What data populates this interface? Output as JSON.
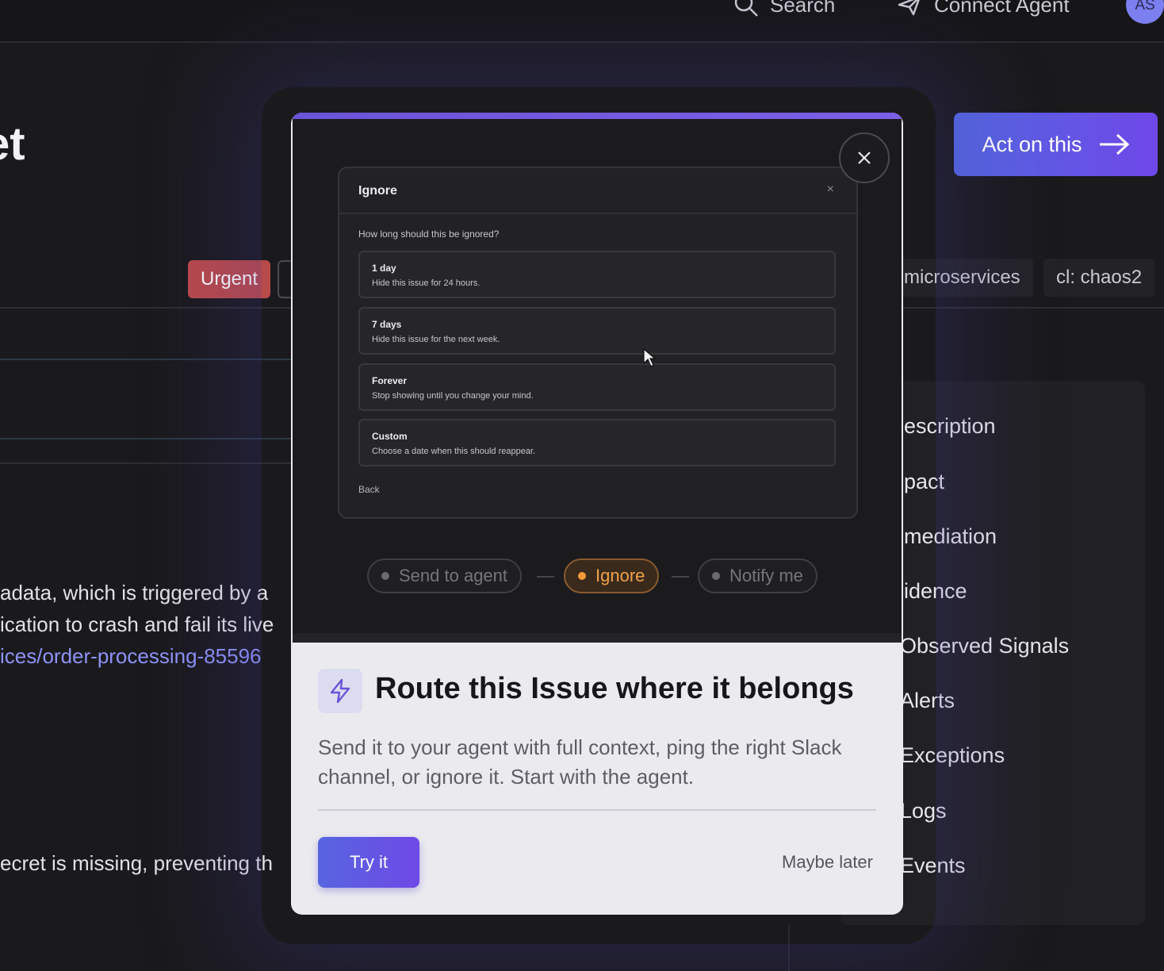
{
  "topbar": {
    "search_label": "Search",
    "connect_label": "Connect Agent",
    "avatar_initials": "AS"
  },
  "page": {
    "title_fragment": "et",
    "act_button_label": "Act on this",
    "tags": [
      "Urgent",
      "microservices",
      "cl: chaos2"
    ],
    "body_lines": [
      "adata, which is triggered by a",
      "ication to crash and fail its live",
      "ices/order-processing-85596",
      "ecret is missing, preventing th"
    ],
    "sidebar_items": [
      "escription",
      "pact",
      "mediation",
      "idence",
      "Observed Signals",
      "Alerts",
      "Exceptions",
      "Logs",
      "Events"
    ]
  },
  "modal": {
    "preview": {
      "dialog_title": "Ignore",
      "dialog_close": "×",
      "question": "How long should this be ignored?",
      "options": [
        {
          "title": "1 day",
          "desc": "Hide this issue for 24 hours."
        },
        {
          "title": "7 days",
          "desc": "Hide this issue for the next week."
        },
        {
          "title": "Forever",
          "desc": "Stop showing until you change your mind."
        },
        {
          "title": "Custom",
          "desc": "Choose a date when this should reappear."
        }
      ],
      "back_label": "Back",
      "steps": [
        "Send to agent",
        "Ignore",
        "Notify me"
      ],
      "active_step": "Ignore"
    },
    "title": "Route this Issue where it belongs",
    "description": "Send it to your agent with full context, ping the right Slack channel, or ignore it. Start with the agent.",
    "primary_label": "Try it",
    "secondary_label": "Maybe later"
  },
  "colors": {
    "accent": "#6a54d8",
    "urgent": "#b94a4a",
    "active_step": "#f39a3c",
    "link": "#8e93f7"
  },
  "icons": [
    "search-icon",
    "agent-icon",
    "arrow-right-icon",
    "close-icon",
    "lightning-icon",
    "cursor-icon"
  ]
}
